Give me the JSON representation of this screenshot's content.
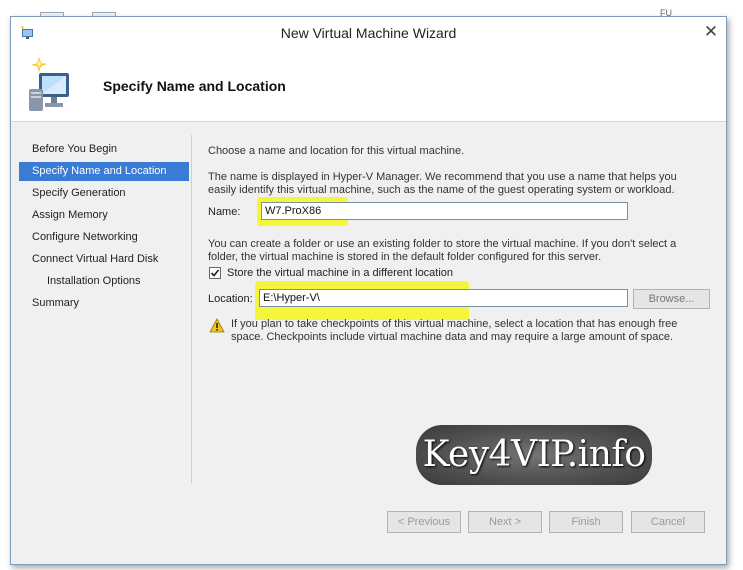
{
  "window": {
    "title": "New Virtual Machine Wizard",
    "close_glyph": "✕"
  },
  "header": {
    "title": "Specify Name and Location"
  },
  "nav": {
    "items": [
      {
        "label": "Before You Begin"
      },
      {
        "label": "Specify Name and Location",
        "active": true
      },
      {
        "label": "Specify Generation"
      },
      {
        "label": "Assign Memory"
      },
      {
        "label": "Configure Networking"
      },
      {
        "label": "Connect Virtual Hard Disk"
      },
      {
        "label": "Installation Options",
        "sub": true
      },
      {
        "label": "Summary"
      }
    ]
  },
  "content": {
    "intro": "Choose a name and location for this virtual machine.",
    "name_help": "The name is displayed in Hyper-V Manager. We recommend that you use a name that helps you easily identify this virtual machine, such as the name of the guest operating system or workload.",
    "name_label": "Name:",
    "name_value": "W7.ProX86",
    "folder_help": "You can create a folder or use an existing folder to store the virtual machine. If you don't select a folder, the virtual machine is stored in the default folder configured for this server.",
    "checkbox_label": "Store the virtual machine in a different location",
    "checkbox_checked": true,
    "location_label": "Location:",
    "location_value": "E:\\Hyper-V\\",
    "browse_label": "Browse...",
    "warning": "If you plan to take checkpoints of this virtual machine, select a location that has enough free space. Checkpoints include virtual machine data and may require a large amount of space."
  },
  "buttons": {
    "previous": "< Previous",
    "next": "Next >",
    "finish": "Finish",
    "cancel": "Cancel"
  },
  "watermark": {
    "text": "Key4VIP.info"
  },
  "background": {
    "corner_text": "FU"
  },
  "colors": {
    "selection": "#3a7bd5",
    "highlight": "#f6f52a"
  }
}
